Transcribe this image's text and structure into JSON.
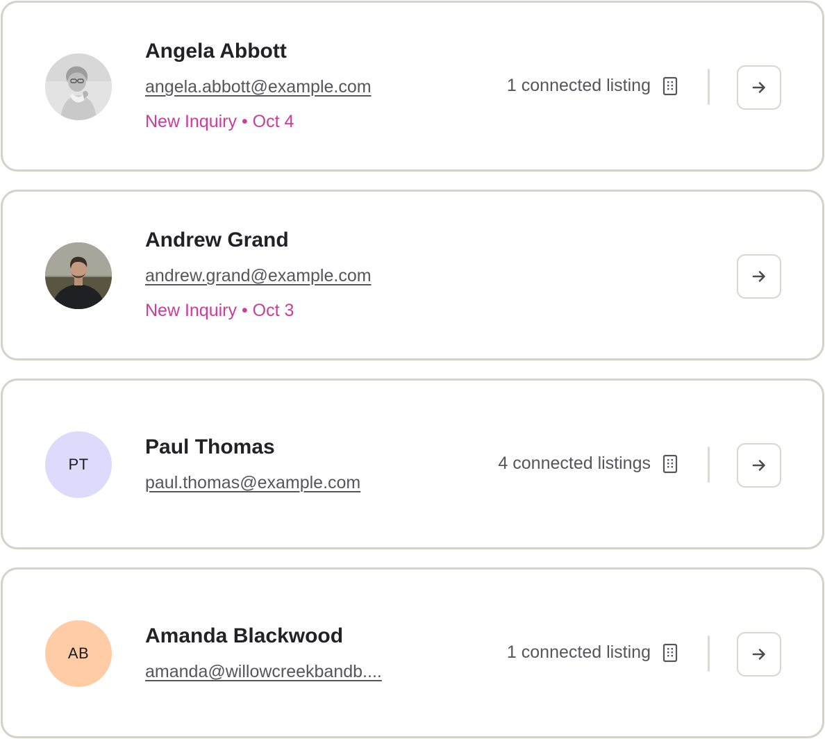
{
  "contacts": [
    {
      "name": "Angela Abbott",
      "email": "angela.abbott@example.com",
      "inquiry": "New Inquiry • Oct 4",
      "listings": "1 connected listing",
      "avatar": "photo-woman-icon"
    },
    {
      "name": "Andrew Grand",
      "email": "andrew.grand@example.com",
      "inquiry": "New Inquiry • Oct 3",
      "avatar": "photo-man-icon"
    },
    {
      "name": "Paul Thomas",
      "email": "paul.thomas@example.com",
      "listings": "4 connected listings",
      "initials": "PT",
      "avatar_color": "#dedafc"
    },
    {
      "name": "Amanda Blackwood",
      "email": "amanda@willowcreekbandb....",
      "listings": "1 connected listing",
      "initials": "AB",
      "avatar_color": "#ffcca6"
    }
  ],
  "icons": {
    "listing": "building-icon",
    "open": "arrow-right-icon"
  },
  "colors": {
    "border": "#d6d2cb",
    "inquiry": "#c83e9a",
    "name": "#222226",
    "muted": "#55555d"
  }
}
